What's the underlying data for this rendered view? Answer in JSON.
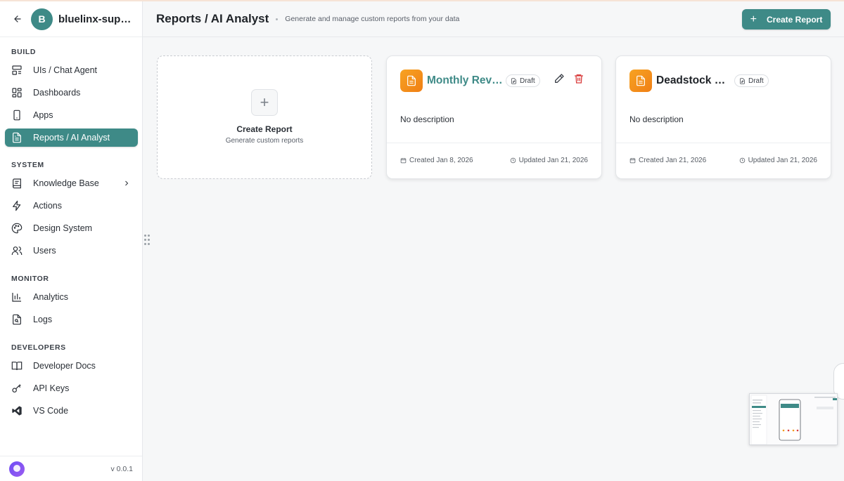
{
  "app": {
    "org_avatar_letter": "B",
    "org_name": "bluelinx-super...",
    "version": "v 0.0.1"
  },
  "sidebar": {
    "sections": [
      {
        "label": "BUILD"
      },
      {
        "label": "SYSTEM"
      },
      {
        "label": "MONITOR"
      },
      {
        "label": "DEVELOPERS"
      }
    ],
    "items": [
      {
        "label": "UIs / Chat Agent",
        "icon": "layout-icon"
      },
      {
        "label": "Dashboards",
        "icon": "dashboard-icon"
      },
      {
        "label": "Apps",
        "icon": "phone-icon"
      },
      {
        "label": "Reports / AI Analyst",
        "icon": "report-icon",
        "active": true
      },
      {
        "label": "Knowledge Base",
        "icon": "book-icon"
      },
      {
        "label": "Actions",
        "icon": "lightning-icon"
      },
      {
        "label": "Design System",
        "icon": "palette-icon"
      },
      {
        "label": "Users",
        "icon": "users-icon"
      },
      {
        "label": "Analytics",
        "icon": "bar-chart-icon"
      },
      {
        "label": "Logs",
        "icon": "file-search-icon"
      },
      {
        "label": "Developer Docs",
        "icon": "open-book-icon"
      },
      {
        "label": "API Keys",
        "icon": "key-icon"
      },
      {
        "label": "VS Code",
        "icon": "vscode-icon"
      }
    ]
  },
  "header": {
    "title": "Reports / AI Analyst",
    "subtitle": "Generate and manage custom reports from your data",
    "create_button": "Create Report"
  },
  "new_report_card": {
    "title": "Create Report",
    "subtitle": "Generate custom reports"
  },
  "reports": [
    {
      "title": "Monthly Reve...",
      "status": "Draft",
      "description": "No description",
      "created": "Created Jan 8, 2026",
      "updated": "Updated Jan 21, 2026",
      "title_color": "#3e8a87"
    },
    {
      "title": "Deadstock Re...",
      "status": "Draft",
      "description": "No description",
      "created": "Created Jan 21, 2026",
      "updated": "Updated Jan 21, 2026",
      "title_color": "#1f2328"
    }
  ],
  "colors": {
    "accent": "#3e8a87",
    "report_icon": "#f39a1c",
    "delete": "#d93c3c"
  }
}
